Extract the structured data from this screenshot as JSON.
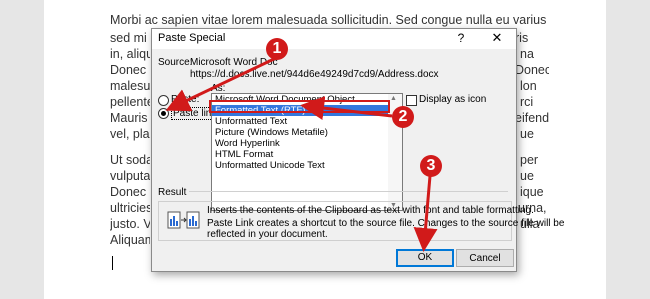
{
  "document": {
    "lines": [
      "Morbi ac sapien vitae lorem malesuada sollicitudin. Sed congue nulla eu varius accumsan. Nunc",
      "sed mi",
      "in, alique",
      "Donec",
      "malesuad",
      "pellentes",
      "Mauris e",
      "vel, place",
      "Ut sodale",
      "vulputate",
      "Donec m",
      "ultricies n",
      "justo. Vi",
      "Aliquam"
    ],
    "right_fragments": [
      "Nunc",
      "ris",
      "na",
      "Donec",
      "lon",
      "rci",
      "eifend",
      "ue",
      "per",
      "ue",
      "ique",
      "urna,",
      "ulla"
    ]
  },
  "dialog": {
    "title": "Paste Special",
    "help": "?",
    "close": "✕",
    "source_label": "Source:",
    "source_name": "Microsoft Word Doc",
    "source_path": "https://d.docs.live.net/944d6e49249d7cd9/Address.docx",
    "as_label": "As:",
    "paste_label": "Paste:",
    "paste_link_label": "Paste link:",
    "list_items": [
      "Microsoft Word Document Object",
      "Formatted Text (RTF)",
      "Unformatted Text",
      "Picture (Windows Metafile)",
      "Word Hyperlink",
      "HTML Format",
      "Unformatted Unicode Text"
    ],
    "selected_index": 1,
    "display_as_icon": "Display as icon",
    "result_label": "Result",
    "result_line1": "Inserts the contents of the Clipboard as text with font and table formatting.",
    "result_line2": "Paste Link creates a shortcut to the source file. Changes to the source file will be",
    "result_line3": "reflected in your document.",
    "ok": "OK",
    "cancel": "Cancel"
  },
  "annotations": [
    "1",
    "2",
    "3"
  ],
  "colors": {
    "accent": "#d11a1a",
    "selection": "#3377dd"
  }
}
